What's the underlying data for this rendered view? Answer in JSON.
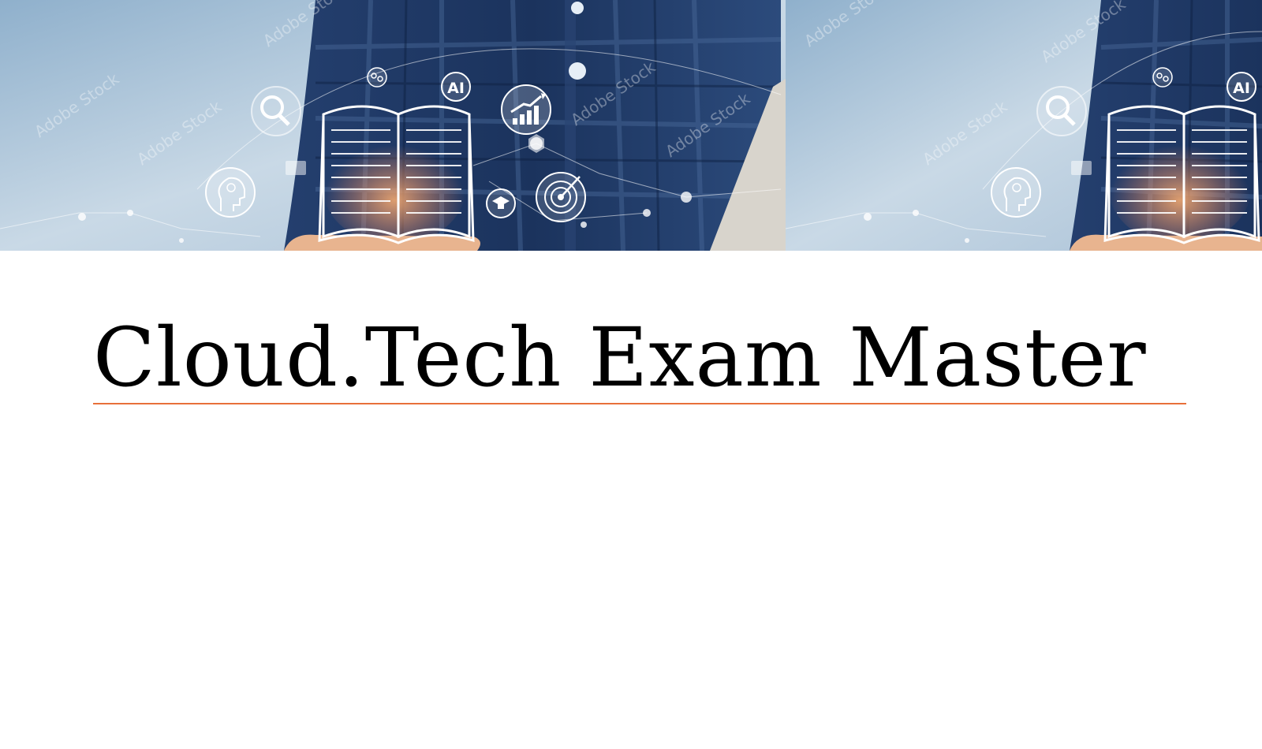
{
  "slide": {
    "title": "Cloud.Tech Exam Master"
  },
  "banner": {
    "image_subject": "hand-holding-open-book-with-education-icons",
    "icons": [
      "search-icon",
      "ai-icon",
      "growth-chart-icon",
      "target-icon",
      "graduation-cap-icon",
      "head-gear-icon",
      "gears-icon",
      "book-icon"
    ],
    "watermark_text": "Adobe Stock"
  },
  "colors": {
    "background": "#ffffff",
    "title_text": "#000000",
    "title_underline": "#e8703a",
    "sky": "#b9cde0",
    "shirt": "#1f3761"
  }
}
